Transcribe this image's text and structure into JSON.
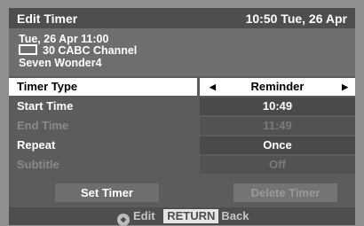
{
  "header": {
    "title": "Edit Timer",
    "clock": "10:50 Tue, 26 Apr"
  },
  "program": {
    "datetime": "Tue, 26 Apr 11:00",
    "channel": "30 CABC Channel",
    "name": "Seven Wonder4",
    "channel_icon": "tv-screen-icon"
  },
  "settings": [
    {
      "label": "Timer Type",
      "value": "Reminder"
    },
    {
      "label": "Start Time",
      "value": "10:49"
    },
    {
      "label": "End Time",
      "value": "11:49"
    },
    {
      "label": "Repeat",
      "value": "Once"
    },
    {
      "label": "Subtitle",
      "value": "Off"
    }
  ],
  "buttons": {
    "set": "Set Timer",
    "delete": "Delete Timer"
  },
  "footer": {
    "edit_label": "Edit",
    "return_key": "RETURN",
    "back_label": "Back",
    "dpad_icon": "dpad-icon"
  },
  "colors": {
    "selected_row": "#ffffff",
    "panel": "#5c5c5c",
    "info_box": "#6e6e6e",
    "disabled_text": "#8a8a8a"
  }
}
